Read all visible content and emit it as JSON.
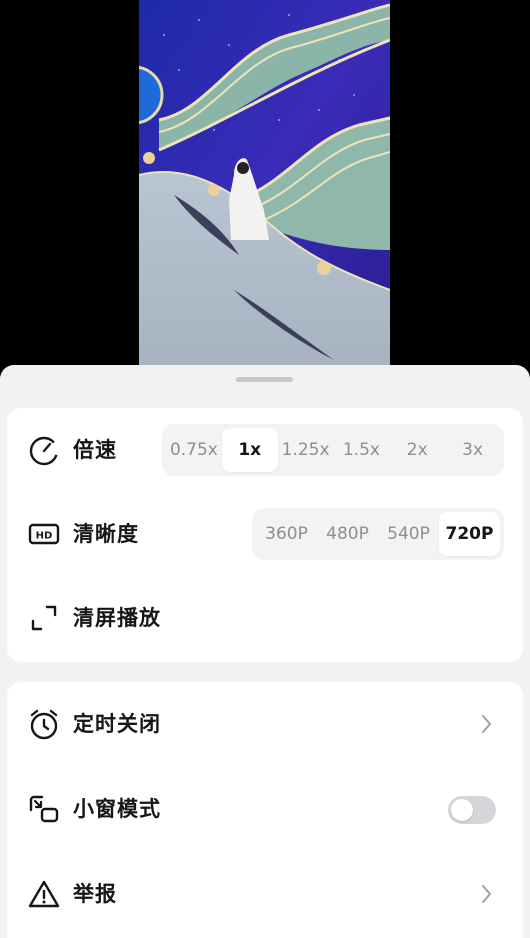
{
  "video": {
    "description_icon": "video-thumbnail-wedding-stage"
  },
  "settings_panel": {
    "playback_card": {
      "speed": {
        "icon": "speed-dial-icon",
        "label": "倍速",
        "options": [
          "0.75x",
          "1x",
          "1.25x",
          "1.5x",
          "2x",
          "3x"
        ],
        "selected": "1x"
      },
      "resolution": {
        "icon": "hd-icon",
        "label": "清晰度",
        "options": [
          "360P",
          "480P",
          "540P",
          "720P"
        ],
        "selected": "720P"
      },
      "clear_screen": {
        "icon": "fullscreen-corners-icon",
        "label": "清屏播放"
      }
    },
    "more_card": {
      "timer": {
        "icon": "alarm-clock-icon",
        "label": "定时关闭"
      },
      "mini_window": {
        "icon": "picture-in-picture-icon",
        "label": "小窗模式",
        "enabled": false
      },
      "report": {
        "icon": "warning-triangle-icon",
        "label": "举报"
      }
    }
  },
  "colors": {
    "sheet_bg": "#f2f2f4",
    "card_bg": "#ffffff",
    "selected_text": "#161616",
    "unselected_text": "#8e8e93",
    "toggle_off": "#d6d6da"
  }
}
